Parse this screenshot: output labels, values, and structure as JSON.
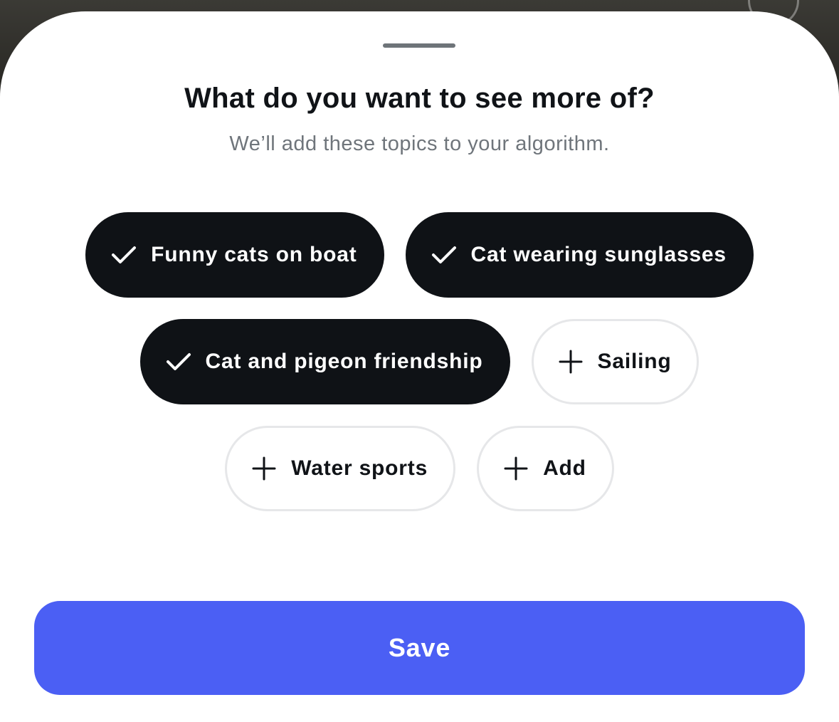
{
  "sheet": {
    "title": "What do you want to see more of?",
    "subtitle": "We’ll add these topics to your algorithm."
  },
  "topics": [
    {
      "label": "Funny cats on boat",
      "selected": true,
      "icon": "check-icon"
    },
    {
      "label": "Cat wearing sunglasses",
      "selected": true,
      "icon": "check-icon"
    },
    {
      "label": "Cat and pigeon friendship",
      "selected": true,
      "icon": "check-icon"
    },
    {
      "label": "Sailing",
      "selected": false,
      "icon": "plus-icon"
    },
    {
      "label": "Water sports",
      "selected": false,
      "icon": "plus-icon"
    }
  ],
  "add_chip": {
    "label": "Add",
    "icon": "plus-icon"
  },
  "save_button": {
    "label": "Save"
  },
  "colors": {
    "selected_chip": "#0f1216",
    "unselected_border": "#e6e7e9",
    "accent": "#4b5ff4",
    "subtitle": "#6f757b"
  }
}
